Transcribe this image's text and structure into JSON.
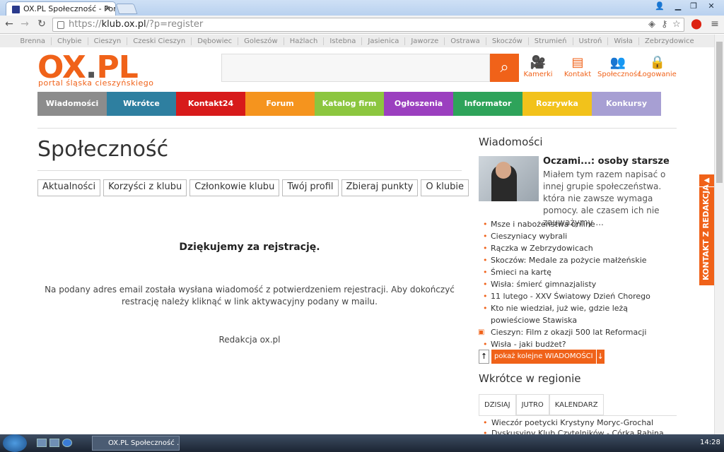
{
  "browser": {
    "tab_title": "OX.PL Społeczność - Portal",
    "url_prefix": "https://",
    "url_domain": "klub.ox.pl",
    "url_rest": "/?p=register"
  },
  "cities": [
    "Brenna",
    "Chybie",
    "Cieszyn",
    "Czeski Cieszyn",
    "Dębowiec",
    "Goleszów",
    "Hażlach",
    "Istebna",
    "Jasienica",
    "Jaworze",
    "Ostrawa",
    "Skoczów",
    "Strumień",
    "Ustroń",
    "Wisła",
    "Zebrzydowice"
  ],
  "header": {
    "logo_main": "OX",
    "logo_dot": ".",
    "logo_pl": "PL",
    "slogan": "portal śląska cieszyńskiego",
    "icons": [
      {
        "label": "Kamerki",
        "icon": "camera-icon"
      },
      {
        "label": "Kontakt",
        "icon": "document-icon"
      },
      {
        "label": "Społeczność",
        "icon": "people-icon"
      },
      {
        "label": "Logowanie",
        "icon": "lock-icon"
      }
    ]
  },
  "menu": [
    {
      "label": "Wiadomości",
      "color": "#8c8c8c"
    },
    {
      "label": "Wkrótce",
      "color": "#2e7fa0"
    },
    {
      "label": "Kontakt24",
      "color": "#d71a1a"
    },
    {
      "label": "Forum",
      "color": "#f5941e"
    },
    {
      "label": "Katalog firm",
      "color": "#8cc63f"
    },
    {
      "label": "Ogłoszenia",
      "color": "#9b3fbf"
    },
    {
      "label": "Informator",
      "color": "#2ea35a"
    },
    {
      "label": "Rozrywka",
      "color": "#f2c21b"
    },
    {
      "label": "Konkursy",
      "color": "#a79fd3"
    }
  ],
  "page": {
    "title": "Społeczność",
    "subtabs": [
      "Aktualności",
      "Korzyści z klubu",
      "Członkowie klubu",
      "Twój profil",
      "Zbieraj punkty",
      "O klubie"
    ],
    "thanks": "Dziękujemy za rejstrację.",
    "message": "Na podany adres email została wysłana wiadomość z potwierdzeniem rejestracji. Aby dokończyć restrację należy kliknąć w link aktywacyjny podany w mailu.",
    "signature": "Redakcja ox.pl"
  },
  "sidebar": {
    "news_heading": "Wiadomości",
    "featured_title": "Oczami...: osoby starsze",
    "featured_text": "Miałem tym razem napisać o innej grupie społeczeństwa. która nie zawsze wymaga pomocy. ale czasem ich nie zauważymy ...",
    "news": [
      "Msze i nabożeństwa online",
      "Cieszyniacy wybrali",
      "Rączka w Zebrzydowicach",
      "Skoczów: Medale za pożycie małżeńskie",
      "Śmieci na kartę",
      "Wisła: śmierć gimnazjalisty",
      "11 lutego - XXV Światowy Dzień Chorego",
      "Kto nie wiedział, już wie, gdzie leżą powieściowe Stawiska",
      "Cieszyn: Film z okazji 500 lat Reformacji",
      "Wisła - jaki budżet?"
    ],
    "more_label": "pokaż kolejne WIADOMOŚCI",
    "events_heading": "Wkrótce w regionie",
    "event_tabs": [
      "DZISIAJ",
      "JUTRO",
      "KALENDARZ"
    ],
    "events": [
      "Wieczór poetycki Krystyny Moryc-Grochal",
      "Dyskusyjny Klub Czytelników - Córka Rabina"
    ]
  },
  "kontakt_tab": "KONTAKT Z REDAKCJA",
  "taskbar": {
    "task_label": "OX.PL Społeczność ...",
    "clock": "14:28"
  }
}
